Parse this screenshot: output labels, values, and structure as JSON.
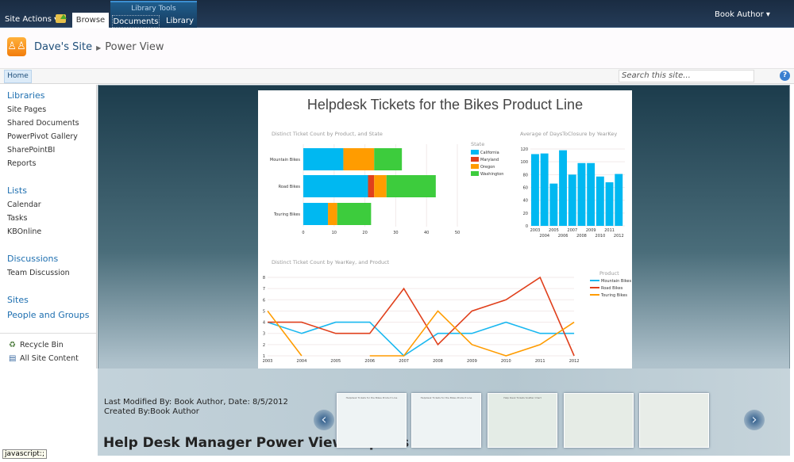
{
  "topbar": {
    "site_actions": "Site Actions ▾",
    "browse": "Browse",
    "library_tools": "Library Tools",
    "documents": "Documents",
    "library": "Library",
    "user": "Book Author ▾"
  },
  "header": {
    "site": "Dave's Site",
    "page": "Power View",
    "logo_icon": "sharepoint-people-icon"
  },
  "ribbon": {
    "home": "Home",
    "search_placeholder": "Search this site...",
    "search_icon": "⚲",
    "help": "?"
  },
  "nav": {
    "libraries": "Libraries",
    "library_items": [
      "Site Pages",
      "Shared Documents",
      "PowerPivot Gallery",
      "SharePointBI",
      "Reports"
    ],
    "lists": "Lists",
    "list_items": [
      "Calendar",
      "Tasks",
      "KBOnline"
    ],
    "discussions": "Discussions",
    "discussion_items": [
      "Team Discussion"
    ],
    "sites": "Sites",
    "people": "People and Groups",
    "recycle": "Recycle Bin",
    "all_content": "All Site Content"
  },
  "report": {
    "title": "Helpdesk Tickets for the Bikes Product Line"
  },
  "chart_data": [
    {
      "type": "bar",
      "stacked": true,
      "orientation": "horizontal",
      "title": "Distinct Ticket Count by Product, and State",
      "legend_title": "State",
      "legend_position": "right",
      "categories": [
        "Mountain Bikes",
        "Road Bikes",
        "Touring Bikes"
      ],
      "series": [
        {
          "name": "California",
          "color": "#00b8f1",
          "values": [
            13,
            21,
            8
          ]
        },
        {
          "name": "Maryland",
          "color": "#e0401c",
          "values": [
            0,
            2,
            0
          ]
        },
        {
          "name": "Oregon",
          "color": "#ff9c00",
          "values": [
            10,
            4,
            3
          ]
        },
        {
          "name": "Washington",
          "color": "#3dcc3d",
          "values": [
            9,
            16,
            11
          ]
        }
      ],
      "xlim": [
        0,
        50
      ],
      "xticks": [
        0,
        10,
        20,
        30,
        40,
        50
      ]
    },
    {
      "type": "bar",
      "title": "Average of DaysToClosure by YearKey",
      "color": "#00b8f1",
      "categories": [
        "2003",
        "2004",
        "2005",
        "2006",
        "2007",
        "2008",
        "2009",
        "2010",
        "2011",
        "2012"
      ],
      "values": [
        112,
        113,
        66,
        118,
        80,
        98,
        98,
        77,
        68,
        81
      ],
      "ylim": [
        0,
        120
      ],
      "yticks": [
        0,
        20,
        40,
        60,
        80,
        100,
        120
      ]
    },
    {
      "type": "line",
      "title": "Distinct Ticket Count by YearKey, and Product",
      "legend_title": "Product",
      "legend_position": "right",
      "x": [
        "2003",
        "2004",
        "2005",
        "2006",
        "2007",
        "2008",
        "2009",
        "2010",
        "2011",
        "2012"
      ],
      "series": [
        {
          "name": "Mountain Bikes",
          "color": "#1ab8f0",
          "values": [
            4,
            3,
            4,
            4,
            1,
            3,
            3,
            4,
            3,
            3
          ]
        },
        {
          "name": "Road Bikes",
          "color": "#e0401c",
          "values": [
            4,
            4,
            3,
            3,
            7,
            2,
            5,
            6,
            8,
            1
          ]
        },
        {
          "name": "Touring Bikes",
          "color": "#ff9c00",
          "values": [
            5,
            1,
            null,
            1,
            1,
            5,
            2,
            1,
            2,
            4
          ]
        }
      ],
      "ylim": [
        1,
        8
      ],
      "yticks": [
        1,
        2,
        3,
        4,
        5,
        6,
        7,
        8
      ]
    }
  ],
  "bottom": {
    "modified": "Last Modified By: Book Author,  Date: 8/5/2012",
    "created": "Created By:Book Author",
    "report_name": "Help Desk Manager Power View Reports",
    "thumb_titles": [
      "Helpdesk Tickets for the Bikes Product Line",
      "Helpdesk Tickets for the Bikes Product Line",
      "Help Desk Tickets Scatter Chart",
      "",
      ""
    ],
    "prev": "‹",
    "next": "›"
  },
  "status": "javascript:;"
}
